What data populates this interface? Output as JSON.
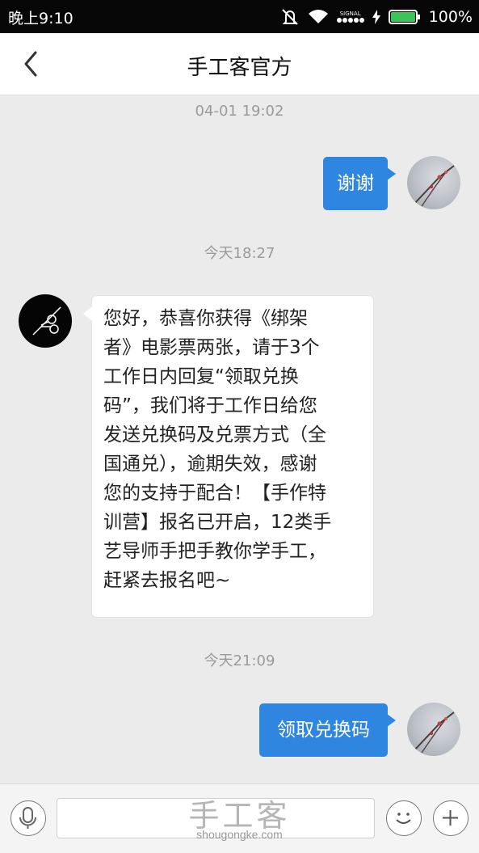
{
  "status_bar": {
    "time": "晚上9:10",
    "signal_label": "SIGNAL",
    "battery_percent": "100%",
    "battery_level": 1.0
  },
  "header": {
    "title": "手工客官方"
  },
  "messages": [
    {
      "timestamp": "04-01 19:02",
      "direction": "outgoing",
      "text": "谢谢"
    },
    {
      "timestamp": "今天18:27",
      "direction": "incoming",
      "lines": [
        "您好，恭喜你获得《绑架",
        "者》电影票两张，请于3个",
        "工作日内回复“领取兑换",
        "码”，我们将于工作日给您",
        "发送兑换码及兑票方式（全",
        "国通兑），逾期失效，感谢",
        "您的支持于配合！【手作特",
        "训营】报名已开启，12类手",
        "艺导师手把手教你学手工，",
        "赶紧去报名吧~"
      ]
    },
    {
      "timestamp": "今天21:09",
      "direction": "outgoing",
      "text": "领取兑换码"
    }
  ],
  "input_bar": {
    "placeholder": ""
  },
  "watermark": {
    "main": "手工客",
    "sub": "shougongke.com"
  },
  "colors": {
    "accent": "#2f86e0",
    "status_bar": "#060606",
    "chat_background": "#ebebeb",
    "battery": "#3cc35a"
  },
  "icons": [
    "back-chevron-icon",
    "mute-vibrate-icon",
    "wifi-icon",
    "charging-icon",
    "battery-icon",
    "scissors-logo-icon",
    "microphone-icon",
    "emoji-icon",
    "plus-icon"
  ]
}
